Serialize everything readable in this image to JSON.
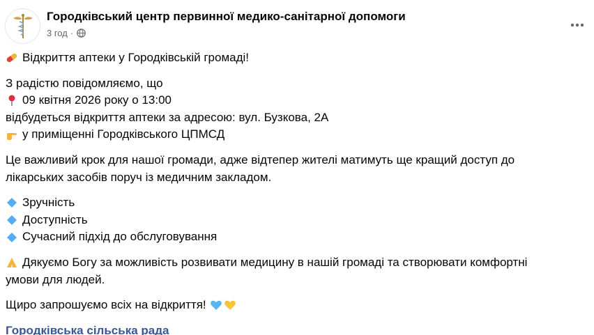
{
  "post": {
    "page_name": "Городківський центр первинної медико-санітарної допомоги",
    "time": "3 год",
    "separator": "·",
    "audience_icon": "globe-icon",
    "more_icon": "more-horizontal-icon",
    "title": "Відкриття аптеки у Городківській громаді!",
    "title_emoji": "pill-icon",
    "intro": "З радістю повідомляємо, що",
    "date_line": "09 квітня 2026 року о 13:00",
    "date_emoji": "pin-icon",
    "address_line": "відбудеться відкриття аптеки за адресою: вул. Бузкова, 2А",
    "location_line": "у приміщенні Городківського ЦПМСД",
    "location_emoji": "point-right-icon",
    "paragraph_1a": "Це важливий крок для нашої громади, адже відтепер жителі матимуть ще кращий доступ до",
    "paragraph_1b": "лікарських засобів поруч із медичним закладом.",
    "bullets": [
      "Зручність",
      "Доступність",
      "Сучасний підхід до обслуговування"
    ],
    "bullet_emoji": "blue-diamond-icon",
    "thanks_a": "Дякуємо Богу за можливість розвивати медицину в нашій громаді та створювати комфортні",
    "thanks_b": "умови для людей.",
    "thanks_emoji": "folded-hands-icon",
    "invite": "Щиро запрошуємо всіх на відкриття!",
    "invite_emoji": [
      "blue-heart-icon",
      "yellow-heart-icon"
    ],
    "mention": "Городківська сільська рада"
  },
  "colors": {
    "text": "#050505",
    "secondary": "#65676b",
    "link": "#385898",
    "blue_heart": "#5bb4ef",
    "yellow_heart": "#f6c33b"
  }
}
